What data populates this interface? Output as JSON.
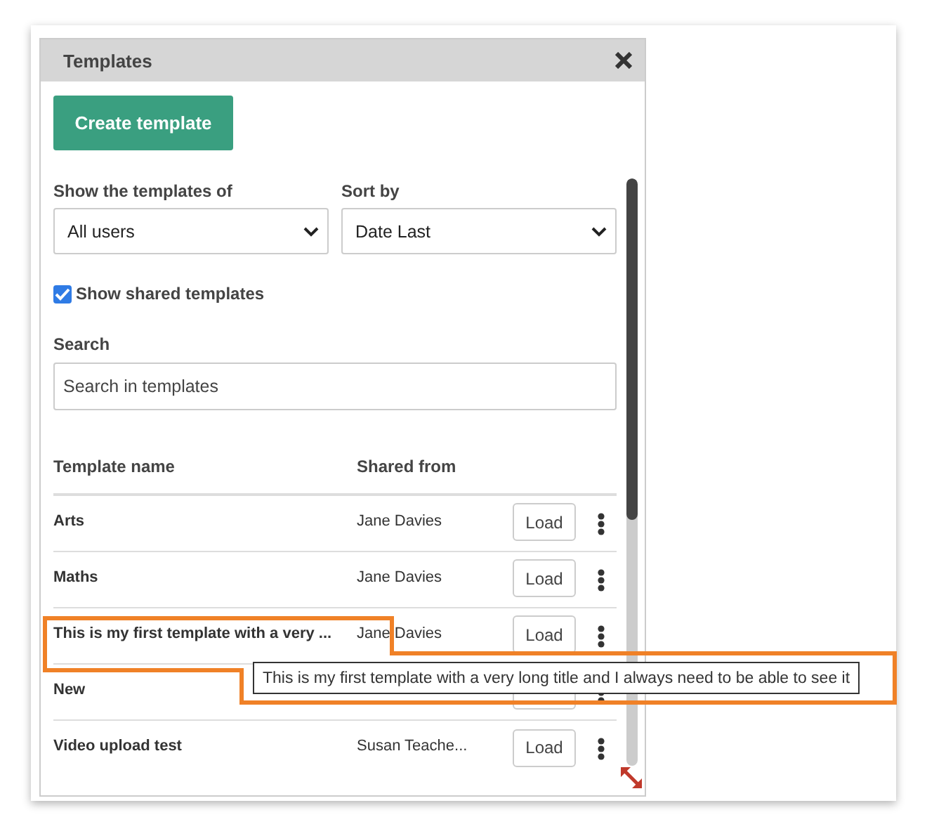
{
  "dialog": {
    "title": "Templates"
  },
  "create_button": "Create template",
  "filters": [
    {
      "label": "Show the templates of",
      "value": "All users"
    },
    {
      "label": "Sort by",
      "value": "Date Last"
    }
  ],
  "show_shared": {
    "label": "Show shared templates",
    "checked": true
  },
  "search": {
    "label": "Search",
    "placeholder": "Search in templates"
  },
  "table": {
    "columns": [
      "Template name",
      "Shared from"
    ],
    "rows": [
      {
        "name": "Arts",
        "shared_from": "Jane Davies",
        "action": "Load"
      },
      {
        "name": "Maths",
        "shared_from": "Jane Davies",
        "action": "Load"
      },
      {
        "name": "This is my first template with a very ...",
        "shared_from": "Jane Davies",
        "action": "Load"
      },
      {
        "name": "New"
      },
      {
        "name": "Video upload test",
        "shared_from": "Susan Teache...",
        "action": "Load"
      }
    ]
  },
  "tooltip": "This is my first template with a very long title and I always need to be able to see it"
}
